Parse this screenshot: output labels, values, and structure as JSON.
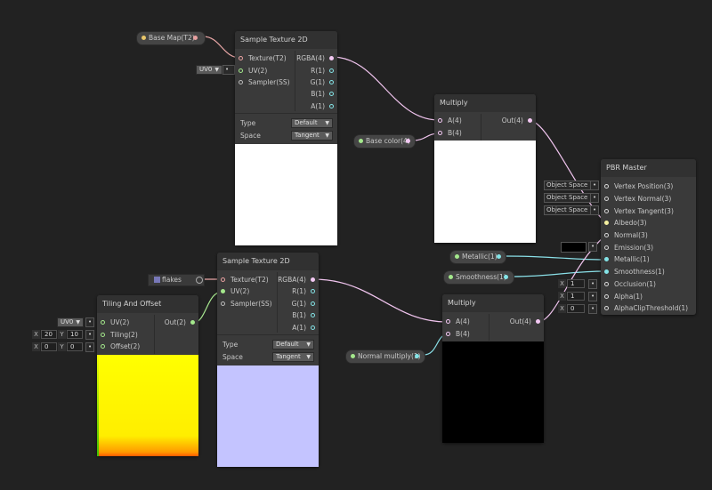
{
  "colors": {
    "background": "#222222",
    "node_body": "#3a3a3a",
    "texture_port": "#e8a0a0",
    "vector2_port": "#a4e88c",
    "vector1_port": "#84e4e7",
    "vector4_port": "#f3c8f3",
    "wire_vector4": "#f0c4ee",
    "wire_vector1": "#8ae0e8",
    "wire_vector2": "#a8e890"
  },
  "properties": {
    "base_map": "Base Map(T2)",
    "base_color": "Base color(4)",
    "flakes": "flakes",
    "metallic": "Metallic(1)",
    "smoothness": "Smoothness(1)",
    "normal_multiply": "Normal multiply(1)"
  },
  "uv_field": "UV0",
  "sample1": {
    "title": "Sample Texture 2D",
    "inputs": [
      "Texture(T2)",
      "UV(2)",
      "Sampler(SS)"
    ],
    "outputs": [
      "RGBA(4)",
      "R(1)",
      "G(1)",
      "B(1)",
      "A(1)"
    ],
    "type_label": "Type",
    "type_value": "Default",
    "space_label": "Space",
    "space_value": "Tangent"
  },
  "sample2": {
    "title": "Sample Texture 2D",
    "inputs": [
      "Texture(T2)",
      "UV(2)",
      "Sampler(SS)"
    ],
    "outputs": [
      "RGBA(4)",
      "R(1)",
      "G(1)",
      "B(1)",
      "A(1)"
    ],
    "type_label": "Type",
    "type_value": "Default",
    "space_label": "Space",
    "space_value": "Tangent"
  },
  "multiply1": {
    "title": "Multiply",
    "inputs": [
      "A(4)",
      "B(4)"
    ],
    "output": "Out(4)"
  },
  "multiply2": {
    "title": "Multiply",
    "inputs": [
      "A(4)",
      "B(4)"
    ],
    "output": "Out(4)"
  },
  "tiling": {
    "title": "Tiling And Offset",
    "inputs": [
      "UV(2)",
      "Tiling(2)",
      "Offset(2)"
    ],
    "output": "Out(2)",
    "uv_value": "UV0",
    "tiling_x_label": "X",
    "tiling_x": "20",
    "tiling_y_label": "Y",
    "tiling_y": "10",
    "offset_x_label": "X",
    "offset_x": "0",
    "offset_y_label": "Y",
    "offset_y": "0"
  },
  "master": {
    "title": "PBR Master",
    "inputs": [
      "Vertex Position(3)",
      "Vertex Normal(3)",
      "Vertex Tangent(3)",
      "Albedo(3)",
      "Normal(3)",
      "Emission(3)",
      "Metallic(1)",
      "Smoothness(1)",
      "Occlusion(1)",
      "Alpha(1)",
      "AlphaClipThreshold(1)"
    ],
    "space_fields": [
      "Object Space",
      "Object Space",
      "Object Space"
    ],
    "occlusion_x_label": "X",
    "occlusion_value": "1",
    "alpha_x_label": "X",
    "alpha_value": "1",
    "clip_x_label": "X",
    "clip_value": "0"
  }
}
